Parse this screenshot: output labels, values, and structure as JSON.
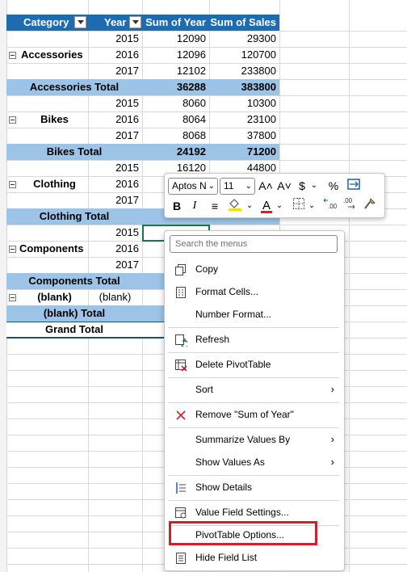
{
  "pivot": {
    "headers": {
      "category": "Category",
      "year": "Year",
      "sum_of_year": "Sum of Year",
      "sum_of_sales": "Sum of Sales"
    },
    "groups": [
      {
        "name": "Accessories",
        "rows": [
          {
            "year": "2015",
            "sum_year": "12090",
            "sales": "29300"
          },
          {
            "year": "2016",
            "sum_year": "12096",
            "sales": "120700"
          },
          {
            "year": "2017",
            "sum_year": "12102",
            "sales": "233800"
          }
        ],
        "total_label": "Accessories Total",
        "total_year": "36288",
        "total_sales": "383800"
      },
      {
        "name": "Bikes",
        "rows": [
          {
            "year": "2015",
            "sum_year": "8060",
            "sales": "10300"
          },
          {
            "year": "2016",
            "sum_year": "8064",
            "sales": "23100"
          },
          {
            "year": "2017",
            "sum_year": "8068",
            "sales": "37800"
          }
        ],
        "total_label": "Bikes Total",
        "total_year": "24192",
        "total_sales": "71200"
      },
      {
        "name": "Clothing",
        "rows": [
          {
            "year": "2015",
            "sum_year": "16120",
            "sales": "44800"
          },
          {
            "year": "2016",
            "sum_year": "",
            "sales": ""
          },
          {
            "year": "2017",
            "sum_year": "",
            "sales": ""
          }
        ],
        "total_label": "Clothing Total",
        "total_year": "",
        "total_sales": ""
      },
      {
        "name": "Components",
        "rows": [
          {
            "year": "2015",
            "sum_year": "",
            "sales": ""
          },
          {
            "year": "2016",
            "sum_year": "",
            "sales": ""
          },
          {
            "year": "2017",
            "sum_year": "",
            "sales": ""
          }
        ],
        "total_label": "Components Total",
        "total_year": "",
        "total_sales": ""
      },
      {
        "name": "(blank)",
        "rows": [
          {
            "year": "(blank)",
            "sum_year": "",
            "sales": ""
          }
        ],
        "total_label": "(blank) Total",
        "total_year": "",
        "total_sales": ""
      }
    ],
    "grand_total_label": "Grand Total"
  },
  "mini_toolbar": {
    "font_name": "Aptos N",
    "font_size": "11",
    "grow_font": "A˄",
    "shrink_font": "A˅",
    "currency": "$",
    "percent": "%",
    "bold": "B",
    "italic": "I",
    "font_color_letter": "A"
  },
  "context_menu": {
    "search_placeholder": "Search the menus",
    "items": [
      {
        "label": "Copy"
      },
      {
        "label": "Format Cells..."
      },
      {
        "label": "Number Format..."
      },
      {
        "label": "Refresh"
      },
      {
        "label": "Delete PivotTable"
      },
      {
        "label": "Sort"
      },
      {
        "label": "Remove \"Sum of Year\""
      },
      {
        "label": "Summarize Values By"
      },
      {
        "label": "Show Values As"
      },
      {
        "label": "Show Details"
      },
      {
        "label": "Value Field Settings..."
      },
      {
        "label": "PivotTable Options..."
      },
      {
        "label": "Hide Field List"
      }
    ]
  },
  "colors": {
    "header_blue": "#1f6bb0",
    "subtotal_blue": "#9dc3e6",
    "highlight_red": "#d0202a",
    "select_green": "#107c41"
  }
}
